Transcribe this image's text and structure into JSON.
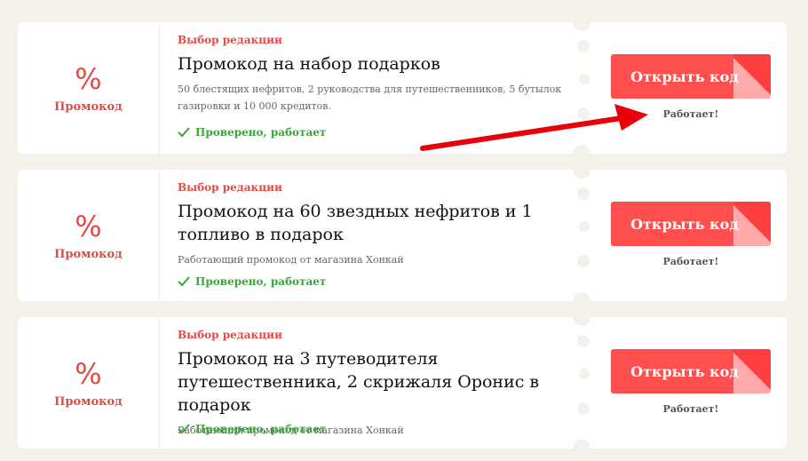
{
  "coupons": [
    {
      "percent": "%",
      "left_label": "Промокод",
      "tag": "Выбор редакции",
      "title": "Промокод на набор подарков",
      "description": "50 блестящих нефритов, 2 руководства для путешественников, 5 бутылок газировки и 10 000 кредитов.",
      "verified": "Проверено, работает",
      "button": "Открыть код",
      "status": "Работает!"
    },
    {
      "percent": "%",
      "left_label": "Промокод",
      "tag": "Выбор редакции",
      "title": "Промокод на 60 звездных нефритов и 1 топливо в подарок",
      "description": "Работающий промокод от магазина Хонкай",
      "verified": "Проверено, работает",
      "button": "Открыть код",
      "status": "Работает!"
    },
    {
      "percent": "%",
      "left_label": "Промокод",
      "tag": "Выбор редакции",
      "title": "Промокод на 3 путеводителя путешественника, 2 скрижаля Оронис в подарок",
      "description": "Работающий промокод от магазина Хонкай",
      "verified": "Проверено, работает",
      "button": "Открыть код",
      "status": "Работает!"
    }
  ],
  "colors": {
    "accent": "#ff4e4e",
    "tag": "#e14b46",
    "verified": "#3aa63a",
    "background": "#f3f1ea",
    "arrow": "#e8000b"
  },
  "icons": {
    "verified": "check-icon",
    "annotation": "red-arrow"
  }
}
